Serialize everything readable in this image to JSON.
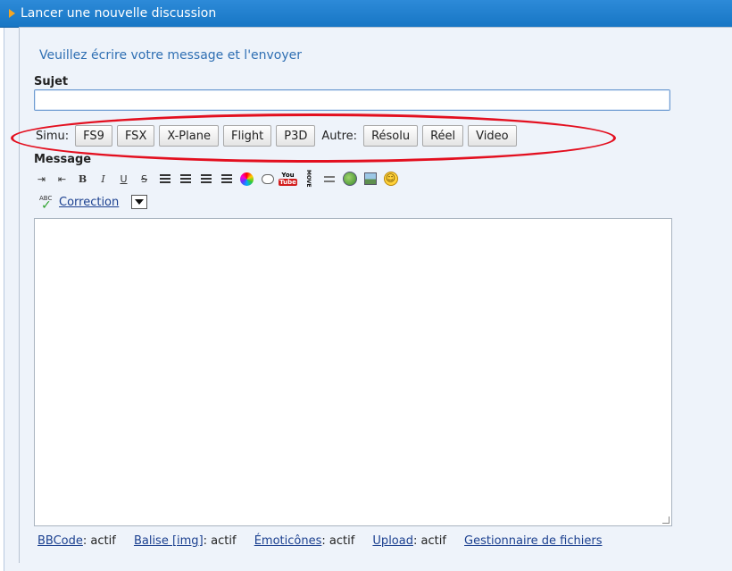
{
  "window": {
    "title": "Lancer une nouvelle discussion"
  },
  "form": {
    "legend": "Veuillez écrire votre message et l'envoyer",
    "subject_label": "Sujet",
    "subject_value": "",
    "tag_prefix_simu": "Simu:",
    "tag_prefix_autre": "Autre:",
    "simu_tags": [
      "FS9",
      "FSX",
      "X-Plane",
      "Flight",
      "P3D"
    ],
    "autre_tags": [
      "Résolu",
      "Réel",
      "Video"
    ],
    "message_label": "Message",
    "toolbar_icons": [
      "indent-left-icon",
      "indent-right-icon",
      "bold-icon",
      "italic-icon",
      "underline-icon",
      "strike-icon",
      "align-left-icon",
      "align-center-icon",
      "align-right-icon",
      "justify-icon",
      "color-wheel-icon",
      "quote-icon",
      "youtube-icon",
      "mov-icon",
      "hr-icon",
      "globe-link-icon",
      "image-icon",
      "smiley-icon"
    ],
    "toolbar_text": {
      "bold": "B",
      "italic": "I",
      "underline": "U",
      "strike": "S",
      "youtube_top": "You",
      "youtube_bottom": "Tube",
      "mov": "MOVE",
      "smiley": "☺"
    },
    "correction_label": "Correction",
    "correction_icon_text": "ABC",
    "message_value": ""
  },
  "status": {
    "bbcode_link": "BBCode",
    "bbcode_state": ": actif",
    "img_link": "Balise [img]",
    "img_state": ": actif",
    "emoticons_link": "Émoticônes",
    "emoticons_state": ": actif",
    "upload_link": "Upload",
    "upload_state": ": actif",
    "file_manager_link": "Gestionnaire de fichiers"
  },
  "colors": {
    "titlebar": "#1f7fcf",
    "highlight_ellipse": "#e30f1f",
    "panel": "#eef3fa",
    "link": "#1a3f8f"
  }
}
